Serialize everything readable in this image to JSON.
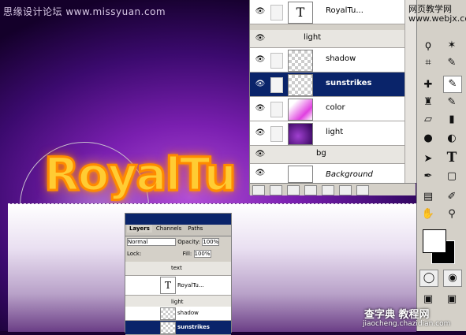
{
  "watermark_top_left": "思缘设计论坛 www.missyuan.com",
  "watermark_top_right": [
    "网页教学网",
    "www.webjx.com"
  ],
  "watermark_bottom": {
    "brand": "查字典 教程网",
    "url": "jiaocheng.chazidian.com"
  },
  "canvas_text": "RoyalTu",
  "layers_panel": {
    "rows": [
      {
        "name": "RoyalTu...",
        "type": "text",
        "thumb": "T"
      },
      {
        "name": "light",
        "type": "group"
      },
      {
        "name": "shadow",
        "type": "layer"
      },
      {
        "name": "sunstrikes",
        "type": "layer",
        "selected": true
      },
      {
        "name": "color",
        "type": "layer"
      },
      {
        "name": "light",
        "type": "layer"
      },
      {
        "name": "bg",
        "type": "group"
      },
      {
        "name": "Background",
        "type": "background"
      }
    ]
  },
  "small_layers_panel": {
    "tabs": [
      "Layers",
      "Channels",
      "Paths"
    ],
    "blend_mode": "Normal",
    "opacity_label": "Opacity:",
    "opacity_value": "100%",
    "lock_label": "Lock:",
    "fill_label": "Fill:",
    "fill_value": "100%",
    "rows": [
      {
        "name": "text",
        "type": "group"
      },
      {
        "name": "RoyalTu...",
        "type": "text",
        "thumb": "T"
      },
      {
        "name": "light",
        "type": "group"
      },
      {
        "name": "shadow",
        "type": "layer"
      },
      {
        "name": "sunstrikes",
        "type": "layer",
        "selected": true
      }
    ]
  },
  "colors": {
    "accent_selected": "#0a246a",
    "foreground": "#ffffff",
    "background": "#000000"
  }
}
